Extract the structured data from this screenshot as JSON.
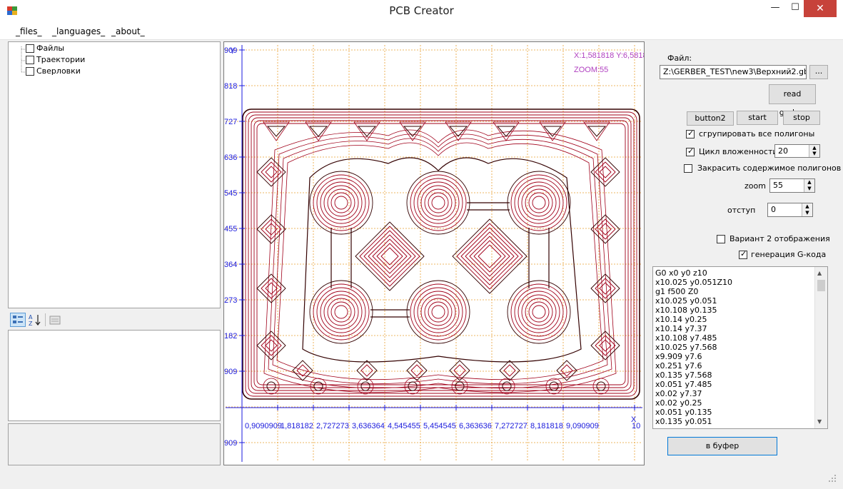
{
  "window": {
    "title": "PCB Creator",
    "minimize": "—",
    "maximize": "☐",
    "close": "✕"
  },
  "menu": [
    "_files_",
    "_languages_",
    "_about_"
  ],
  "tree": [
    "Файлы",
    "Траектории",
    "Сверловки"
  ],
  "plot": {
    "coord_readout": "X:1,581818 Y:6,5818",
    "zoom_readout": "ZOOM:55",
    "y_axis_label": "Y",
    "x_axis_label": "X",
    "y_ticks": [
      "909",
      "818",
      "727",
      "636",
      "545",
      "455",
      "364",
      "273",
      "182",
      "909",
      "909"
    ],
    "x_ticks": [
      "0,9090909",
      "1,818182",
      "2,727273",
      "3,636364",
      "4,545455",
      "5,454545",
      "6,363636",
      "7,272727",
      "8,181818",
      "9,090909",
      "10"
    ]
  },
  "controls": {
    "file_label": "Файл:",
    "file_path": "Z:\\GERBER_TEST\\new3\\Верхний2.gbr",
    "browse": "...",
    "read_gerber": "read gerber",
    "button2": "button2",
    "start": "start",
    "stop": "stop",
    "group_polygons": "сгрупировать все полигоны",
    "nesting_cycle": "Цикл вложенности",
    "nesting_value": "20",
    "fill_polygons": "Закрасить содержимое полигонов",
    "zoom_label": "zoom",
    "zoom_value": "55",
    "offset_label": "отступ",
    "offset_value": "0",
    "variant2": "Вариант 2 отображения",
    "gcode_gen": "генерация G-кода",
    "to_buffer": "в буфер"
  },
  "gcode_lines": [
    "G0 x0 y0 z10",
    "x10.025 y0.051Z10",
    "g1 f500 Z0",
    "x10.025 y0.051",
    "x10.108 y0.135",
    "x10.14 y0.25",
    "x10.14 y7.37",
    "x10.108 y7.485",
    "x10.025 y7.568",
    "x9.909 y7.6",
    "x0.251 y7.6",
    "x0.135 y7.568",
    "x0.051 y7.485",
    "x0.02 y7.37",
    "x0.02 y0.25",
    "x0.051 y0.135",
    "x0.135 y0.051"
  ],
  "colors": {
    "trace": "#a0001a",
    "grid": "#e8a030",
    "axis_text": "#1a1adc",
    "readout": "#b040c0",
    "close": "#c7423a"
  }
}
